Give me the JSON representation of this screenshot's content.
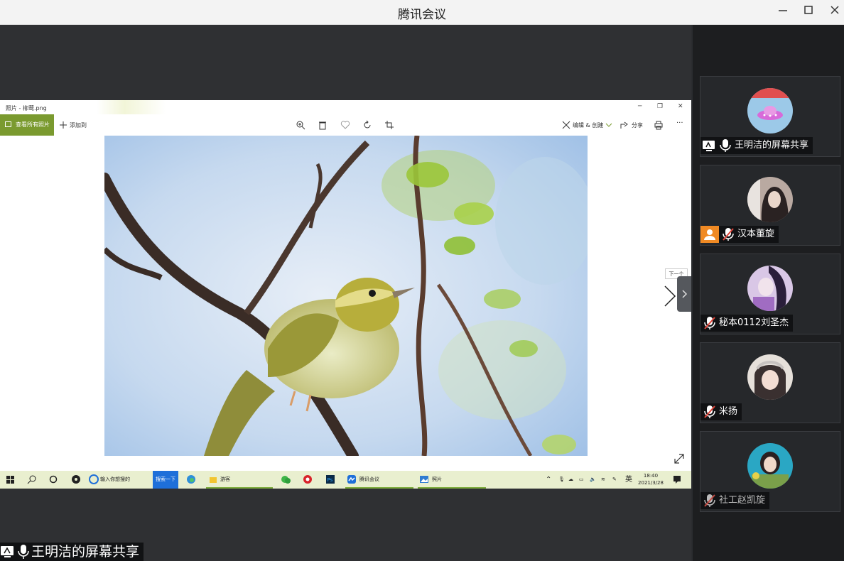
{
  "window": {
    "title": "腾讯会议"
  },
  "photos_app": {
    "title": "照片 - 柳莺.png",
    "see_all_label": "查看所有照片",
    "add_to_label": "添加到",
    "edit_label": "编辑 & 创建",
    "share_label": "分享",
    "next_tooltip": "下一个"
  },
  "taskbar": {
    "search_placeholder": "输入你想搜的",
    "search_button": "搜索一下",
    "items": [
      {
        "label": "游客"
      },
      {
        "label": "腾讯会议"
      },
      {
        "label": "照片"
      }
    ],
    "ime": "英",
    "time": "18:40",
    "date": "2021/3/28"
  },
  "participants": [
    {
      "name": "王明洁的屏幕共享",
      "avatar": "ufo-icon",
      "sharing": true,
      "mic": "on"
    },
    {
      "name": "汉本董旋",
      "avatar": "girl-photo",
      "host": true,
      "mic": "muted"
    },
    {
      "name": "秘本0112刘圣杰",
      "avatar": "anime-photo",
      "mic": "muted"
    },
    {
      "name": "米扬",
      "avatar": "girl-photo-2",
      "mic": "muted"
    },
    {
      "name": "社工赵凯旋",
      "avatar": "flower-photo",
      "mic": "muted",
      "dim": true
    }
  ],
  "bottom_label": "王明洁的屏幕共享",
  "colors": {
    "accent_green": "#7a9a2f",
    "mute_red": "#e0453a",
    "sidebar_bg": "#1d1e20"
  }
}
